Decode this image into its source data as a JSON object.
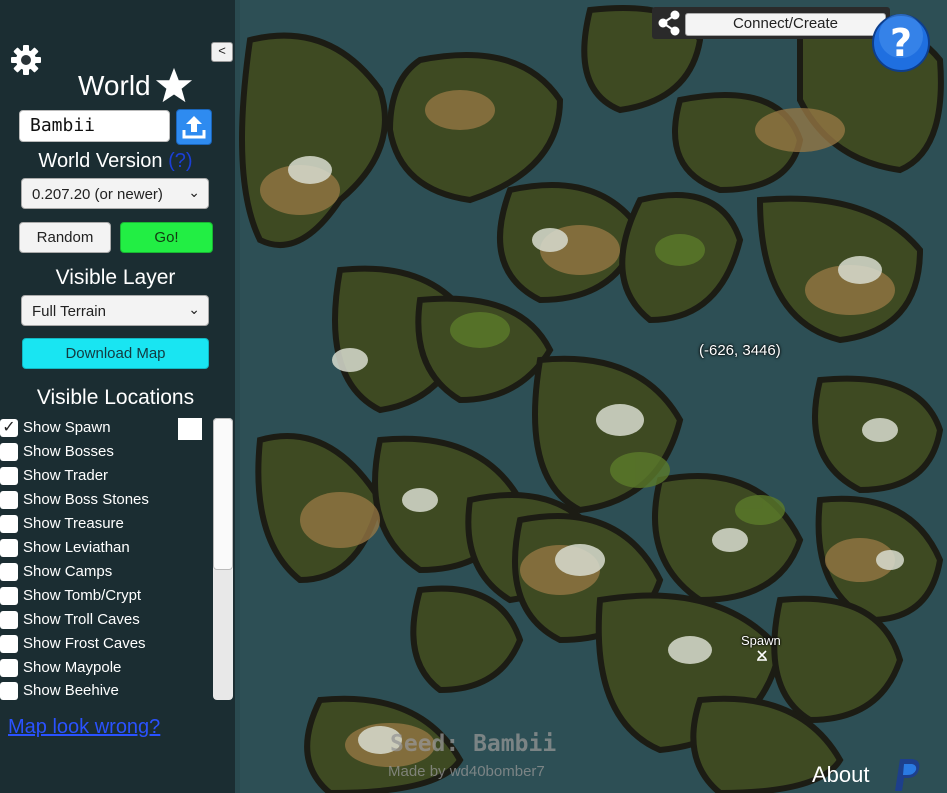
{
  "sidebar": {
    "world_title": "World",
    "seed_value": "Bambii",
    "world_version_label": "World Version",
    "world_version_help": "(?)",
    "world_version_selected": "0.207.20 (or newer)",
    "random_label": "Random",
    "go_label": "Go!",
    "visible_layer_label": "Visible Layer",
    "visible_layer_selected": "Full Terrain",
    "download_label": "Download Map",
    "visible_locations_label": "Visible Locations",
    "collapse_label": "<",
    "locations": [
      {
        "label": "Show Spawn",
        "checked": true
      },
      {
        "label": "Show Bosses",
        "checked": false
      },
      {
        "label": "Show Trader",
        "checked": false
      },
      {
        "label": "Show Boss Stones",
        "checked": false
      },
      {
        "label": "Show Treasure",
        "checked": false
      },
      {
        "label": "Show Leviathan",
        "checked": false
      },
      {
        "label": "Show Camps",
        "checked": false
      },
      {
        "label": "Show Tomb/Crypt",
        "checked": false
      },
      {
        "label": "Show Troll Caves",
        "checked": false
      },
      {
        "label": "Show Frost Caves",
        "checked": false
      },
      {
        "label": "Show Maypole",
        "checked": false
      },
      {
        "label": "Show Beehive",
        "checked": false
      }
    ],
    "map_wrong_link": "Map look wrong?"
  },
  "topbar": {
    "connect_label": "Connect/Create",
    "help_symbol": "?"
  },
  "map": {
    "coordinates": "(-626, 3446)",
    "spawn_label": "Spawn",
    "seed_text": "Seed: Bambii",
    "made_by": "Made by wd40bomber7",
    "about_label": "About"
  },
  "colors": {
    "go_green": "#22ee44",
    "download_cyan": "#19e5f2",
    "upload_blue": "#2e8bf0",
    "link_blue": "#2a52ff",
    "help_blue": "#1f6fe0"
  }
}
